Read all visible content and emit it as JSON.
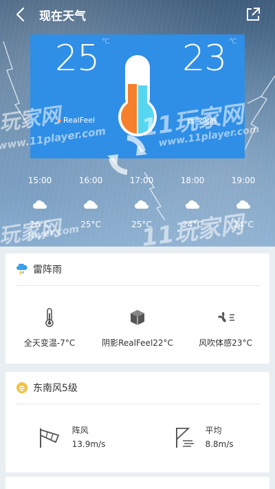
{
  "header": {
    "title": "现在天气",
    "back_icon": "chevron-left-icon",
    "share_icon": "share-external-icon"
  },
  "current": {
    "realfeel_temp": "25",
    "realfeel_unit": "°C",
    "realfeel_label": "RealFeel",
    "somatic_temp": "23",
    "somatic_unit": "°C",
    "somatic_label": "体感温度"
  },
  "hourly": [
    {
      "time": "15:00",
      "temp": "26°C",
      "icon": "cloud-icon"
    },
    {
      "time": "16:00",
      "temp": "25°C",
      "icon": "cloud-icon"
    },
    {
      "time": "17:00",
      "temp": "25°C",
      "icon": "cloud-icon"
    },
    {
      "time": "18:00",
      "temp": "24°C",
      "icon": "cloud-icon"
    },
    {
      "time": "19:00",
      "temp": "24°C",
      "icon": "cloud-icon"
    }
  ],
  "watermark": {
    "site_cn": "玩家网",
    "site_url": "www.11player.com",
    "site_url_short": "layer.com",
    "brand": "11玩家网",
    "brand_url": "www.11player.com"
  },
  "weather_card": {
    "condition": "雷阵雨",
    "condition_icon": "thunderstorm-rain-icon",
    "stats": [
      {
        "label": "全天变温-7°C",
        "icon": "thermometer-icon"
      },
      {
        "label": "阴影RealFeel22°C",
        "icon": "shade-cube-icon"
      },
      {
        "label": "风吹体感23°C",
        "icon": "fan-wind-icon"
      }
    ]
  },
  "wind_card": {
    "title": "东南风5级",
    "title_icon": "wind-level-icon",
    "items": [
      {
        "label": "阵风",
        "value": "13.9m/s",
        "icon": "windsock-icon"
      },
      {
        "label": "平均",
        "value": "8.8m/s",
        "icon": "wind-flag-icon"
      }
    ]
  },
  "colors": {
    "panel_blue": "#2f8ee6",
    "thermo_orange": "#f57f2a",
    "thermo_cyan": "#56d6f0",
    "accent_yellow": "#f3c13c"
  }
}
